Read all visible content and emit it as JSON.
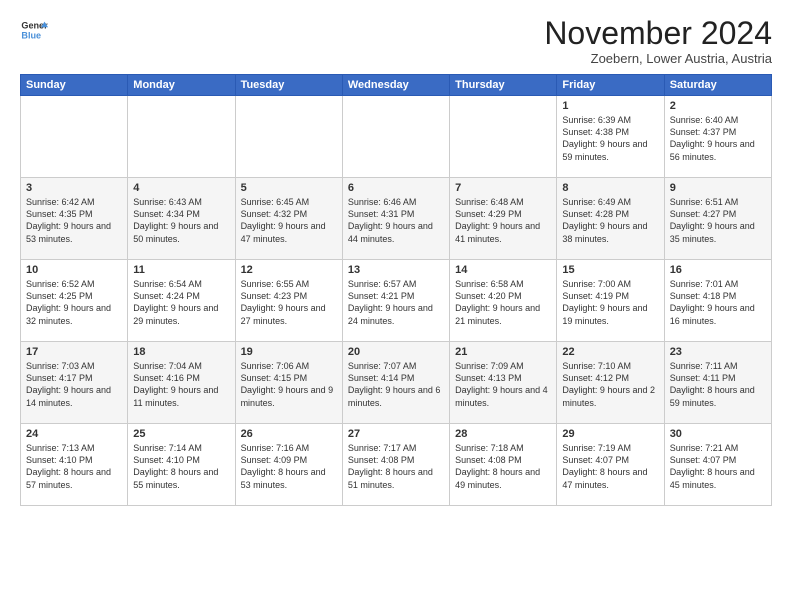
{
  "logo": {
    "text1": "General",
    "text2": "Blue"
  },
  "title": "November 2024",
  "location": "Zoebern, Lower Austria, Austria",
  "days_of_week": [
    "Sunday",
    "Monday",
    "Tuesday",
    "Wednesday",
    "Thursday",
    "Friday",
    "Saturday"
  ],
  "weeks": [
    [
      {
        "day": "",
        "content": ""
      },
      {
        "day": "",
        "content": ""
      },
      {
        "day": "",
        "content": ""
      },
      {
        "day": "",
        "content": ""
      },
      {
        "day": "",
        "content": ""
      },
      {
        "day": "1",
        "content": "Sunrise: 6:39 AM\nSunset: 4:38 PM\nDaylight: 9 hours and 59 minutes."
      },
      {
        "day": "2",
        "content": "Sunrise: 6:40 AM\nSunset: 4:37 PM\nDaylight: 9 hours and 56 minutes."
      }
    ],
    [
      {
        "day": "3",
        "content": "Sunrise: 6:42 AM\nSunset: 4:35 PM\nDaylight: 9 hours and 53 minutes."
      },
      {
        "day": "4",
        "content": "Sunrise: 6:43 AM\nSunset: 4:34 PM\nDaylight: 9 hours and 50 minutes."
      },
      {
        "day": "5",
        "content": "Sunrise: 6:45 AM\nSunset: 4:32 PM\nDaylight: 9 hours and 47 minutes."
      },
      {
        "day": "6",
        "content": "Sunrise: 6:46 AM\nSunset: 4:31 PM\nDaylight: 9 hours and 44 minutes."
      },
      {
        "day": "7",
        "content": "Sunrise: 6:48 AM\nSunset: 4:29 PM\nDaylight: 9 hours and 41 minutes."
      },
      {
        "day": "8",
        "content": "Sunrise: 6:49 AM\nSunset: 4:28 PM\nDaylight: 9 hours and 38 minutes."
      },
      {
        "day": "9",
        "content": "Sunrise: 6:51 AM\nSunset: 4:27 PM\nDaylight: 9 hours and 35 minutes."
      }
    ],
    [
      {
        "day": "10",
        "content": "Sunrise: 6:52 AM\nSunset: 4:25 PM\nDaylight: 9 hours and 32 minutes."
      },
      {
        "day": "11",
        "content": "Sunrise: 6:54 AM\nSunset: 4:24 PM\nDaylight: 9 hours and 29 minutes."
      },
      {
        "day": "12",
        "content": "Sunrise: 6:55 AM\nSunset: 4:23 PM\nDaylight: 9 hours and 27 minutes."
      },
      {
        "day": "13",
        "content": "Sunrise: 6:57 AM\nSunset: 4:21 PM\nDaylight: 9 hours and 24 minutes."
      },
      {
        "day": "14",
        "content": "Sunrise: 6:58 AM\nSunset: 4:20 PM\nDaylight: 9 hours and 21 minutes."
      },
      {
        "day": "15",
        "content": "Sunrise: 7:00 AM\nSunset: 4:19 PM\nDaylight: 9 hours and 19 minutes."
      },
      {
        "day": "16",
        "content": "Sunrise: 7:01 AM\nSunset: 4:18 PM\nDaylight: 9 hours and 16 minutes."
      }
    ],
    [
      {
        "day": "17",
        "content": "Sunrise: 7:03 AM\nSunset: 4:17 PM\nDaylight: 9 hours and 14 minutes."
      },
      {
        "day": "18",
        "content": "Sunrise: 7:04 AM\nSunset: 4:16 PM\nDaylight: 9 hours and 11 minutes."
      },
      {
        "day": "19",
        "content": "Sunrise: 7:06 AM\nSunset: 4:15 PM\nDaylight: 9 hours and 9 minutes."
      },
      {
        "day": "20",
        "content": "Sunrise: 7:07 AM\nSunset: 4:14 PM\nDaylight: 9 hours and 6 minutes."
      },
      {
        "day": "21",
        "content": "Sunrise: 7:09 AM\nSunset: 4:13 PM\nDaylight: 9 hours and 4 minutes."
      },
      {
        "day": "22",
        "content": "Sunrise: 7:10 AM\nSunset: 4:12 PM\nDaylight: 9 hours and 2 minutes."
      },
      {
        "day": "23",
        "content": "Sunrise: 7:11 AM\nSunset: 4:11 PM\nDaylight: 8 hours and 59 minutes."
      }
    ],
    [
      {
        "day": "24",
        "content": "Sunrise: 7:13 AM\nSunset: 4:10 PM\nDaylight: 8 hours and 57 minutes."
      },
      {
        "day": "25",
        "content": "Sunrise: 7:14 AM\nSunset: 4:10 PM\nDaylight: 8 hours and 55 minutes."
      },
      {
        "day": "26",
        "content": "Sunrise: 7:16 AM\nSunset: 4:09 PM\nDaylight: 8 hours and 53 minutes."
      },
      {
        "day": "27",
        "content": "Sunrise: 7:17 AM\nSunset: 4:08 PM\nDaylight: 8 hours and 51 minutes."
      },
      {
        "day": "28",
        "content": "Sunrise: 7:18 AM\nSunset: 4:08 PM\nDaylight: 8 hours and 49 minutes."
      },
      {
        "day": "29",
        "content": "Sunrise: 7:19 AM\nSunset: 4:07 PM\nDaylight: 8 hours and 47 minutes."
      },
      {
        "day": "30",
        "content": "Sunrise: 7:21 AM\nSunset: 4:07 PM\nDaylight: 8 hours and 45 minutes."
      }
    ]
  ]
}
